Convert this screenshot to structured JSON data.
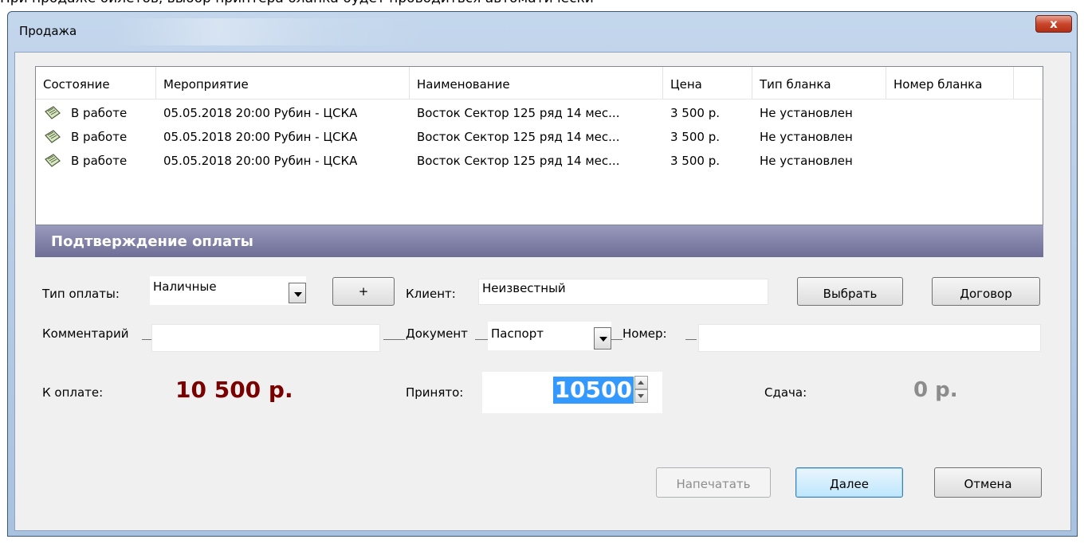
{
  "caption": "При продаже билетов, выбор принтера бланка будет проводиться автоматически",
  "window": {
    "title": "Продажа",
    "close_label": "x"
  },
  "table": {
    "columns": [
      "Состояние",
      "Мероприятие",
      "Наименование",
      "Цена",
      "Тип бланка",
      "Номер бланка"
    ],
    "row_icon": "ticket-icon",
    "rows": [
      {
        "status": "В работе",
        "event": "05.05.2018 20:00 Рубин - ЦСКА",
        "name": "Восток Сектор 125 ряд 14 мес...",
        "price": "3 500 р.",
        "blank_type": "Не установлен",
        "blank_number": ""
      },
      {
        "status": "В работе",
        "event": "05.05.2018 20:00 Рубин - ЦСКА",
        "name": "Восток Сектор 125 ряд 14 мес...",
        "price": "3 500 р.",
        "blank_type": "Не установлен",
        "blank_number": ""
      },
      {
        "status": "В работе",
        "event": "05.05.2018 20:00 Рубин - ЦСКА",
        "name": "Восток Сектор 125 ряд 14 мес...",
        "price": "3 500 р.",
        "blank_type": "Не установлен",
        "blank_number": ""
      }
    ]
  },
  "section": {
    "title": "Подтверждение оплаты"
  },
  "payment": {
    "type_label": "Тип оплаты:",
    "type_value": "Наличные",
    "plus_label": "+",
    "client_label": "Клиент:",
    "client_value": "Неизвестный",
    "select_label": "Выбрать",
    "contract_label": "Договор",
    "comment_label": "Комментарий",
    "comment_value": "",
    "document_label": "Документ",
    "document_value": "Паспорт",
    "number_label": "Номер:",
    "number_value": "",
    "to_pay_label": "К оплате:",
    "to_pay_value": "10 500 р.",
    "accepted_label": "Принято:",
    "accepted_value": "10500",
    "change_label": "Сдача:",
    "change_value": "0 р."
  },
  "buttons": {
    "print": "Напечатать",
    "next": "Далее",
    "cancel": "Отмена"
  },
  "colors": {
    "amount": "#7a0000",
    "section_bar": "#7a7aa3",
    "selection": "#3399ff"
  }
}
